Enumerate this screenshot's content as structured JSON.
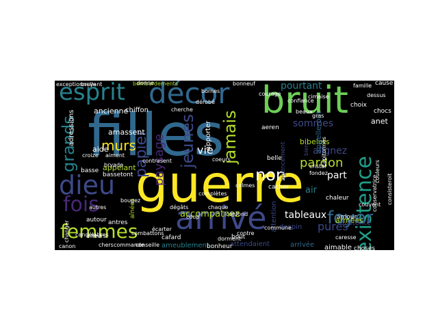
{
  "colors": {
    "background": "#000000",
    "page": "#ffffff",
    "palette": [
      "#fde725",
      "#35b779",
      "#31688e",
      "#3e4989",
      "#440154",
      "#26828e",
      "#1f9e89",
      "#6ece58",
      "#b5de2b",
      "#482878"
    ]
  },
  "words": [
    {
      "text": "filles",
      "color": "#31688e"
    },
    {
      "text": "guerre",
      "color": "#fde725"
    },
    {
      "text": "arrivé",
      "color": "#3e4989"
    },
    {
      "text": "bruit",
      "color": "#6ece58"
    },
    {
      "text": "décor",
      "color": "#31688e"
    },
    {
      "text": "esprit",
      "color": "#26828e"
    },
    {
      "text": "dieu",
      "color": "#3e4989"
    },
    {
      "text": "existence",
      "color": "#1f9e89"
    },
    {
      "text": "femmes",
      "color": "#b5de2b"
    },
    {
      "text": "fois",
      "color": "#482878"
    },
    {
      "text": "foyer",
      "color": "#31688e"
    },
    {
      "text": "grands",
      "color": "#26828e"
    },
    {
      "text": "murs",
      "color": "#fde725"
    },
    {
      "text": "papier",
      "color": "#3e4989"
    },
    {
      "text": "paysage",
      "color": "#482878"
    },
    {
      "text": "jeunes",
      "color": "#3e4989"
    },
    {
      "text": "jamais",
      "color": "#b5de2b"
    },
    {
      "text": "non",
      "color": "#ffffff"
    },
    {
      "text": "pourtant",
      "color": "#26828e"
    },
    {
      "text": "sommes",
      "color": "#3e4989"
    },
    {
      "text": "pardon",
      "color": "#b5de2b"
    },
    {
      "text": "tableaux",
      "color": "#ffffff"
    },
    {
      "text": "purés",
      "color": "#3e4989"
    },
    {
      "text": "vie",
      "color": "#ffffff"
    },
    {
      "text": "part",
      "color": "#ffffff"
    },
    {
      "text": "accompatnez",
      "color": "#b5de2b"
    },
    {
      "text": "alignez",
      "color": "#3e4989"
    },
    {
      "text": "bibelots",
      "color": "#b5de2b"
    },
    {
      "text": "air",
      "color": "#26828e"
    },
    {
      "text": "armées",
      "color": "#b5de2b"
    },
    {
      "text": "amassent",
      "color": "#ffffff"
    },
    {
      "text": "appelant",
      "color": "#b5de2b"
    },
    {
      "text": "aide",
      "color": "#ffffff"
    },
    {
      "text": "ancienne",
      "color": "#ffffff"
    },
    {
      "text": "chiffon",
      "color": "#ffffff"
    },
    {
      "text": "adressions",
      "color": "#ffffff"
    },
    {
      "text": "bombardements",
      "color": "#b5de2b"
    },
    {
      "text": "bonneuf",
      "color": "#ffffff"
    },
    {
      "text": "appelleront",
      "color": "#31688e"
    },
    {
      "text": "anet",
      "color": "#ffffff"
    },
    {
      "text": "chocs",
      "color": "#ffffff"
    },
    {
      "text": "apporter",
      "color": "#ffffff"
    },
    {
      "text": "attendaient",
      "color": "#3e4989"
    },
    {
      "text": "arrivée",
      "color": "#31688e"
    },
    {
      "text": "aimable",
      "color": "#ffffff"
    },
    {
      "text": "ameublement",
      "color": "#26828e"
    },
    {
      "text": "bonheur",
      "color": "#ffffff"
    },
    {
      "text": "austérité",
      "color": "#3e4989"
    },
    {
      "text": "amour",
      "color": "#ffffff"
    },
    {
      "text": "choses",
      "color": "#ffffff"
    },
    {
      "text": "cafard",
      "color": "#ffffff"
    },
    {
      "text": "attention",
      "color": "#3e4989"
    },
    {
      "text": "despin",
      "color": "#3e4989"
    },
    {
      "text": "chaleur",
      "color": "#ffffff"
    },
    {
      "text": "bout",
      "color": "#ffffff"
    },
    {
      "text": "antres",
      "color": "#ffffff"
    },
    {
      "text": "autour",
      "color": "#ffffff"
    },
    {
      "text": "basse",
      "color": "#ffffff"
    },
    {
      "text": "aînées",
      "color": "#b5de2b"
    },
    {
      "text": "changer",
      "color": "#ffffff"
    },
    {
      "text": "canon",
      "color": "#ffffff"
    },
    {
      "text": "chers",
      "color": "#ffffff"
    },
    {
      "text": "commande",
      "color": "#ffffff"
    },
    {
      "text": "conseille",
      "color": "#ffffff"
    },
    {
      "text": "confond",
      "color": "#ffffff"
    },
    {
      "text": "aeren",
      "color": "#ffffff"
    },
    {
      "text": "belle",
      "color": "#ffffff"
    },
    {
      "text": "cristal",
      "color": "#ffffff"
    },
    {
      "text": "cacher",
      "color": "#ffffff"
    },
    {
      "text": "capitonnés",
      "color": "#ffffff"
    },
    {
      "text": "choix",
      "color": "#ffffff"
    },
    {
      "text": "cause",
      "color": "#ffffff"
    },
    {
      "text": "confiance",
      "color": "#ffffff"
    },
    {
      "text": "cimaise",
      "color": "#ffffff"
    },
    {
      "text": "courage",
      "color": "#ffffff"
    },
    {
      "text": "bornes",
      "color": "#ffffff"
    },
    {
      "text": "cherche",
      "color": "#ffffff"
    },
    {
      "text": "bassetont",
      "color": "#ffffff"
    },
    {
      "text": "aiment",
      "color": "#ffffff"
    },
    {
      "text": "croize",
      "color": "#ffffff"
    },
    {
      "text": "bryade",
      "color": "#ffffff"
    },
    {
      "text": "contre",
      "color": "#ffffff"
    },
    {
      "text": "dorment",
      "color": "#ffffff"
    },
    {
      "text": "agencement",
      "color": "#3e4989"
    },
    {
      "text": "bien",
      "color": "#3e4989"
    },
    {
      "text": "commune",
      "color": "#ffffff"
    },
    {
      "text": "caresse",
      "color": "#ffffff"
    },
    {
      "text": "autres",
      "color": "#ffffff"
    },
    {
      "text": "calmes",
      "color": "#ffffff"
    },
    {
      "text": "donne",
      "color": "#ffffff"
    },
    {
      "text": "couvent",
      "color": "#ffffff"
    },
    {
      "text": "bougez",
      "color": "#ffffff"
    },
    {
      "text": "coeurs",
      "color": "#ffffff"
    },
    {
      "text": "dégâts",
      "color": "#ffffff"
    },
    {
      "text": "coup",
      "color": "#ffffff"
    },
    {
      "text": "complètes",
      "color": "#ffffff"
    },
    {
      "text": "chaque",
      "color": "#ffffff"
    },
    {
      "text": "combattons",
      "color": "#ffffff"
    },
    {
      "text": "écarter",
      "color": "#ffffff"
    },
    {
      "text": "ailleurs",
      "color": "#ffffff"
    },
    {
      "text": "beaux",
      "color": "#ffffff"
    },
    {
      "text": "candélabres",
      "color": "#ffffff"
    },
    {
      "text": "contrasent",
      "color": "#ffffff"
    },
    {
      "text": "dérobé",
      "color": "#ffffff"
    },
    {
      "text": "gras",
      "color": "#ffffff"
    },
    {
      "text": "consisteroit",
      "color": "#ffffff"
    },
    {
      "text": "conservatrice",
      "color": "#ffffff"
    },
    {
      "text": "exceptionnelle",
      "color": "#ffffff"
    },
    {
      "text": "famille",
      "color": "#ffffff"
    },
    {
      "text": "fondez",
      "color": "#ffffff"
    },
    {
      "text": "dessus",
      "color": "#ffffff"
    },
    {
      "text": "bruyant",
      "color": "#ffffff"
    },
    {
      "text": "couleurs",
      "color": "#ffffff"
    }
  ]
}
